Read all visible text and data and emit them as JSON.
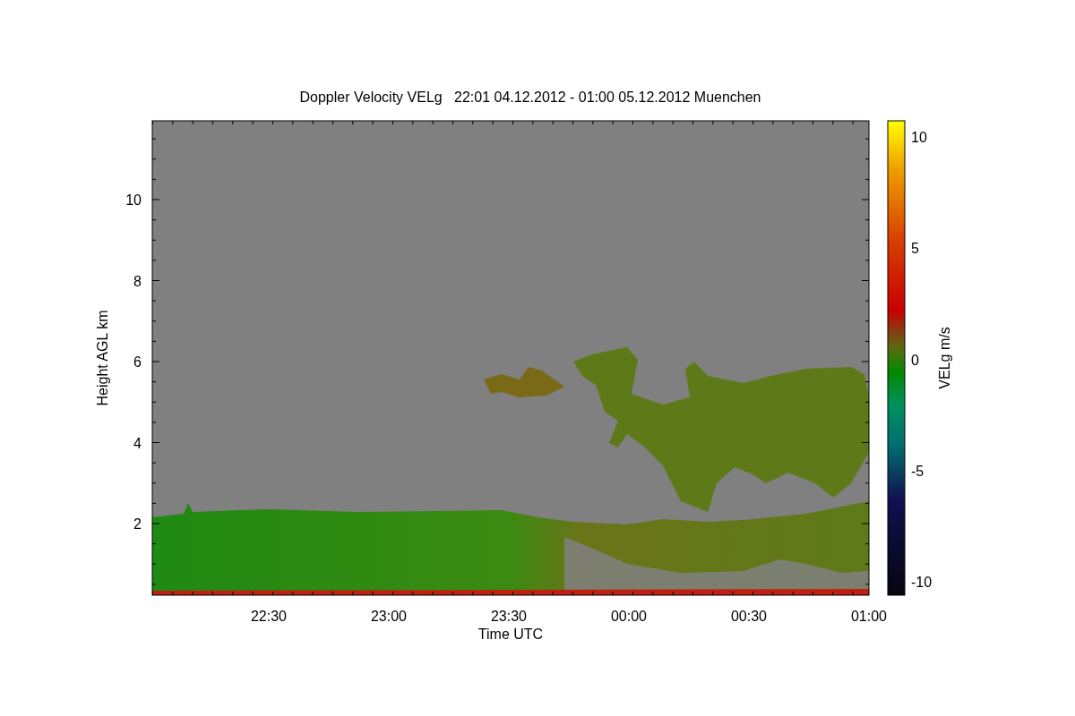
{
  "title": "Doppler Velocity VELg   22:01 04.12.2012 - 01:00 05.12.2012 Muenchen",
  "y_axis": {
    "label": "Height AGL km",
    "ticks": [
      "10",
      "8",
      "6",
      "4",
      "2"
    ]
  },
  "x_axis": {
    "label": "Time UTC",
    "ticks": [
      "22:30",
      "23:00",
      "23:30",
      "00:00",
      "00:30",
      "01:00"
    ]
  },
  "colorbar": {
    "label": "VELg m/s",
    "ticks": [
      "10",
      "5",
      "0",
      "-5",
      "-10"
    ]
  }
}
